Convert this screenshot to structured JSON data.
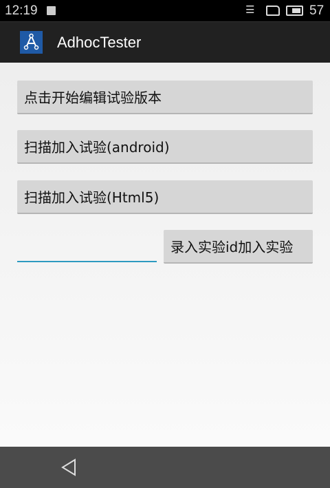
{
  "status_bar": {
    "time": "12:19",
    "battery_level": "57",
    "icons": [
      "notification-icon",
      "wifi-icon",
      "sim-icon",
      "battery-icon"
    ]
  },
  "app_bar": {
    "title": "AdhocTester",
    "logo_icon": "adhoc-logo-icon"
  },
  "main": {
    "edit_button": "点击开始编辑试验版本",
    "scan_android_button": "扫描加入试验(android)",
    "scan_html5_button": "扫描加入试验(Html5)",
    "experiment_id_input": {
      "value": "",
      "placeholder": ""
    },
    "join_by_id_button": "录入实验id加入实验"
  },
  "nav_bar": {
    "back_icon": "back-triangle-icon"
  }
}
